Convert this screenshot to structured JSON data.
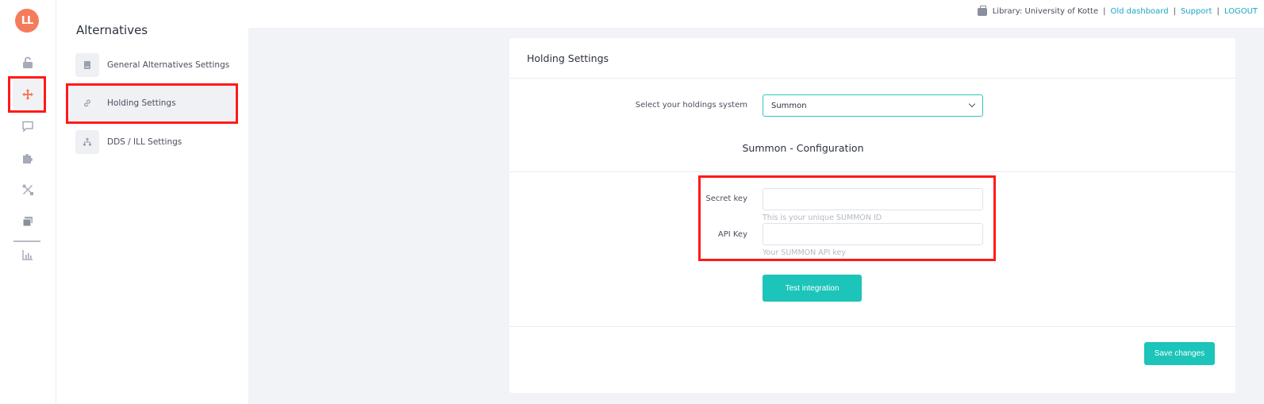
{
  "app": {
    "logo_text": "LL",
    "accent": "#f47c5c",
    "teal": "#1cc4b9",
    "highlight": "#ff1a1a"
  },
  "rail": {
    "items": [
      {
        "icon": "unlock-icon",
        "active": false
      },
      {
        "icon": "move-arrows-icon",
        "active": true
      },
      {
        "icon": "chat-icon",
        "active": false
      },
      {
        "icon": "puzzle-icon",
        "active": false
      },
      {
        "icon": "tools-icon",
        "active": false
      },
      {
        "icon": "windows-icon",
        "active": false
      },
      {
        "icon": "bar-chart-icon",
        "active": false
      }
    ]
  },
  "sidebar": {
    "title": "Alternatives",
    "items": [
      {
        "label": "General Alternatives Settings",
        "icon": "book-icon",
        "active": false
      },
      {
        "label": "Holding Settings",
        "icon": "link-icon",
        "active": true
      },
      {
        "label": "DDS / ILL Settings",
        "icon": "network-icon",
        "active": false
      }
    ]
  },
  "topbar": {
    "library": "Library: University of Kotte",
    "old_dashboard": "Old dashboard",
    "support": "Support",
    "logout": "LOGOUT",
    "separator": "|"
  },
  "card": {
    "title": "Holding Settings",
    "holdings_label": "Select your holdings system",
    "holdings_value": "Summon",
    "section_title": "Summon - Configuration",
    "secret_key_label": "Secret key",
    "secret_key_value": "",
    "secret_key_help": "This is your unique SUMMON ID",
    "api_key_label": "API Key",
    "api_key_value": "",
    "api_key_help": "Your SUMMON API key",
    "test_button": "Test integration",
    "save_button": "Save changes"
  }
}
